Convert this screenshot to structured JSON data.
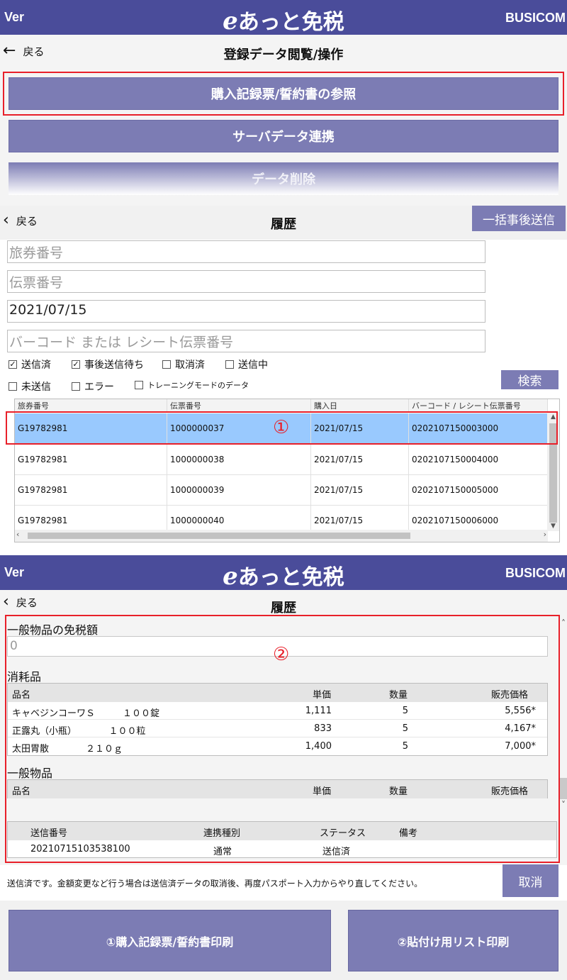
{
  "header": {
    "ver": "Ver",
    "logo_e": "e",
    "logo_text": "あっと免税",
    "brand": "BUSICOM"
  },
  "nav1": {
    "back": "戻る",
    "title": "登録データ閲覧/操作"
  },
  "menu": {
    "btn1": "購入記録票/誓約書の参照",
    "btn2": "サーバデータ連携",
    "btn3": "データ削除"
  },
  "nav2": {
    "back": "戻る",
    "title": "履歴",
    "bulk_send": "一括事後送信"
  },
  "search": {
    "passport_placeholder": "旅券番号",
    "slip_placeholder": "伝票番号",
    "date_value": "2021/07/15",
    "barcode_placeholder": "バーコード または レシート伝票番号",
    "search_button": "検索"
  },
  "filters": [
    {
      "label": "送信済",
      "checked": true
    },
    {
      "label": "事後送信待ち",
      "checked": true
    },
    {
      "label": "取消済",
      "checked": false
    },
    {
      "label": "送信中",
      "checked": false
    },
    {
      "label": "未送信",
      "checked": false
    },
    {
      "label": "エラー",
      "checked": false
    },
    {
      "label": "トレーニングモードのデータ",
      "checked": false
    }
  ],
  "history_table": {
    "columns": [
      "旅券番号",
      "伝票番号",
      "購入日",
      "バーコード / レシート伝票番号"
    ],
    "rows": [
      [
        "G19782981",
        "1000000037",
        "2021/07/15",
        "0202107150003000"
      ],
      [
        "G19782981",
        "1000000038",
        "2021/07/15",
        "0202107150004000"
      ],
      [
        "G19782981",
        "1000000039",
        "2021/07/15",
        "0202107150005000"
      ],
      [
        "G19782981",
        "1000000040",
        "2021/07/15",
        "0202107150006000"
      ]
    ]
  },
  "markers": {
    "one": "①",
    "two": "②"
  },
  "nav3": {
    "back": "戻る",
    "title": "履歴"
  },
  "detail": {
    "general_tax_free_label": "一般物品の免税額",
    "general_tax_free_value": "0",
    "consumables_label": "消耗品",
    "item_columns": [
      "品名",
      "単価",
      "数量",
      "販売価格"
    ],
    "consumables": [
      {
        "name": "キャベジンコーワＳ　　　１００錠",
        "price": "1,111",
        "qty": "5",
        "total": "5,556*"
      },
      {
        "name": "正露丸（小瓶）　　　　１００粒",
        "price": "833",
        "qty": "5",
        "total": "4,167*"
      },
      {
        "name": "太田胃散　　　　２１０ｇ",
        "price": "1,400",
        "qty": "5",
        "total": "7,000*"
      }
    ],
    "general_label": "一般物品",
    "send_columns": [
      "送信番号",
      "連携種別",
      "ステータス",
      "備考"
    ],
    "send_rows": [
      [
        "20210715103538100",
        "通常",
        "送信済",
        ""
      ]
    ]
  },
  "footer": {
    "note": "送信済です。金額変更など行う場合は送信済データの取消後、再度パスポート入力からやり直してください。",
    "cancel": "取消",
    "print1": "①購入記録票/誓約書印刷",
    "print2": "②貼付け用リスト印刷"
  }
}
